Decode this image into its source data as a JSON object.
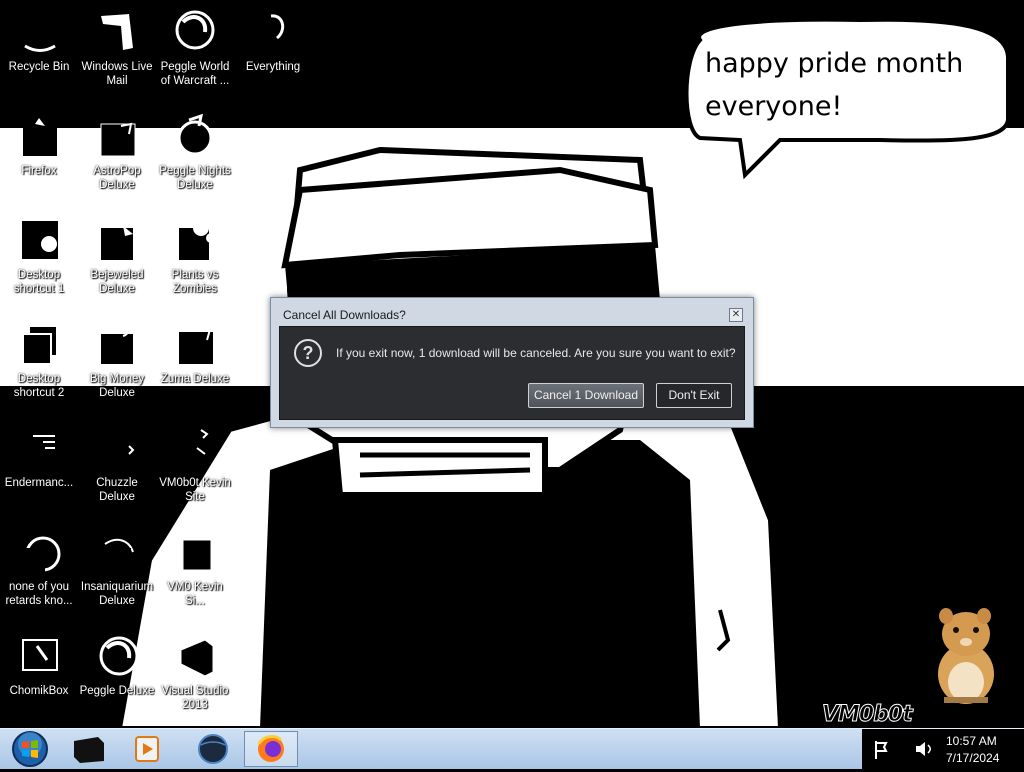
{
  "desktop": {
    "icons": [
      {
        "label": "Recycle Bin",
        "icon": "recycle-bin-icon"
      },
      {
        "label": "Windows Live Mail",
        "icon": "mail-icon"
      },
      {
        "label": "Peggle World of Warcraft ...",
        "icon": "peggle-icon"
      },
      {
        "label": "Everything",
        "icon": "search-app-icon"
      },
      {
        "label": "Firefox",
        "icon": "firefox-icon"
      },
      {
        "label": "AstroPop Deluxe",
        "icon": "game-icon"
      },
      {
        "label": "Peggle Nights Deluxe",
        "icon": "peggle-icon"
      },
      {
        "label": "Desktop shortcut 1",
        "icon": "image-file-icon"
      },
      {
        "label": "Bejeweled Deluxe",
        "icon": "game-icon"
      },
      {
        "label": "Plants vs Zombies",
        "icon": "game-icon"
      },
      {
        "label": "Desktop shortcut 2",
        "icon": "file-icon"
      },
      {
        "label": "Big Money Deluxe",
        "icon": "game-icon"
      },
      {
        "label": "Zuma Deluxe",
        "icon": "game-icon"
      },
      {
        "label": "Endermanc...",
        "icon": "file-icon"
      },
      {
        "label": "Chuzzle Deluxe",
        "icon": "game-icon"
      },
      {
        "label": "VM0b0t Kevin Site",
        "icon": "shortcut-icon"
      },
      {
        "label": "none of you retards kno...",
        "icon": "file-icon"
      },
      {
        "label": "Insaniquarium Deluxe",
        "icon": "game-icon"
      },
      {
        "label": "VM0 Kevin Si...",
        "icon": "shortcut-icon"
      },
      {
        "label": "ChomikBox",
        "icon": "chomikbox-icon"
      },
      {
        "label": "Peggle Deluxe",
        "icon": "peggle-icon"
      },
      {
        "label": "Visual Studio 2013",
        "icon": "visual-studio-icon"
      }
    ]
  },
  "bubble": {
    "text_line1": "happy pride month",
    "text_line2": "everyone!"
  },
  "dialog": {
    "title": "Cancel All Downloads?",
    "close_glyph": "✕",
    "icon_glyph": "?",
    "message": "If you exit now, 1 download will be canceled. Are you sure you want to exit?",
    "buttons": {
      "cancel": "Cancel 1 Download",
      "dont_exit": "Don't Exit"
    }
  },
  "watermark": "VM0b0t",
  "taskbar": {
    "pinned": [
      "terminal-icon",
      "media-player-icon",
      "browser-globe-icon",
      "firefox-icon"
    ],
    "active_index": 3,
    "clock": {
      "time": "10:57 AM",
      "date": "7/17/2024"
    }
  },
  "colors": {
    "taskbar": "#b8d1ec",
    "dialog_body": "#2b2d31",
    "desktop_bg": "#000000"
  }
}
